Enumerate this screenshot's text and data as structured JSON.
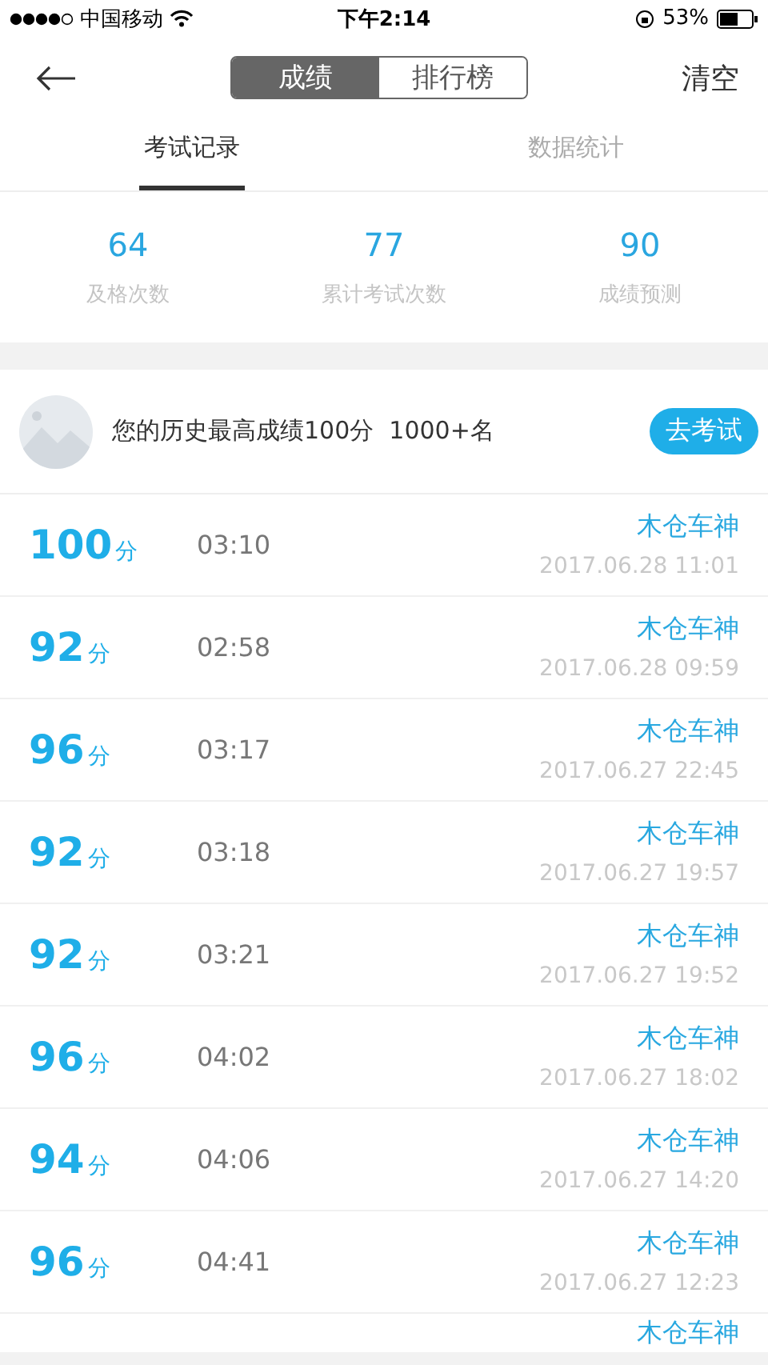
{
  "status_bar": {
    "carrier": "中国移动",
    "time": "下午2:14",
    "battery": "53%"
  },
  "nav": {
    "segments": [
      {
        "label": "成绩",
        "selected": true
      },
      {
        "label": "排行榜",
        "selected": false
      }
    ],
    "action": "清空"
  },
  "tabs": [
    {
      "label": "考试记录",
      "selected": true
    },
    {
      "label": "数据统计",
      "selected": false
    }
  ],
  "stats": [
    {
      "value": "64",
      "label": "及格次数"
    },
    {
      "value": "77",
      "label": "累计考试次数"
    },
    {
      "value": "90",
      "label": "成绩预测"
    }
  ],
  "best": {
    "text": "您的历史最高成绩100分  1000+名",
    "button": "去考试"
  },
  "records": [
    {
      "score": "100",
      "unit": "分",
      "duration": "03:10",
      "name": "木仓车神",
      "date": "2017.06.28 11:01"
    },
    {
      "score": "92",
      "unit": "分",
      "duration": "02:58",
      "name": "木仓车神",
      "date": "2017.06.28 09:59"
    },
    {
      "score": "96",
      "unit": "分",
      "duration": "03:17",
      "name": "木仓车神",
      "date": "2017.06.27 22:45"
    },
    {
      "score": "92",
      "unit": "分",
      "duration": "03:18",
      "name": "木仓车神",
      "date": "2017.06.27 19:57"
    },
    {
      "score": "92",
      "unit": "分",
      "duration": "03:21",
      "name": "木仓车神",
      "date": "2017.06.27 19:52"
    },
    {
      "score": "96",
      "unit": "分",
      "duration": "04:02",
      "name": "木仓车神",
      "date": "2017.06.27 18:02"
    },
    {
      "score": "94",
      "unit": "分",
      "duration": "04:06",
      "name": "木仓车神",
      "date": "2017.06.27 14:20"
    },
    {
      "score": "96",
      "unit": "分",
      "duration": "04:41",
      "name": "木仓车神",
      "date": "2017.06.27 12:23"
    },
    {
      "name": "木仓车神"
    }
  ]
}
